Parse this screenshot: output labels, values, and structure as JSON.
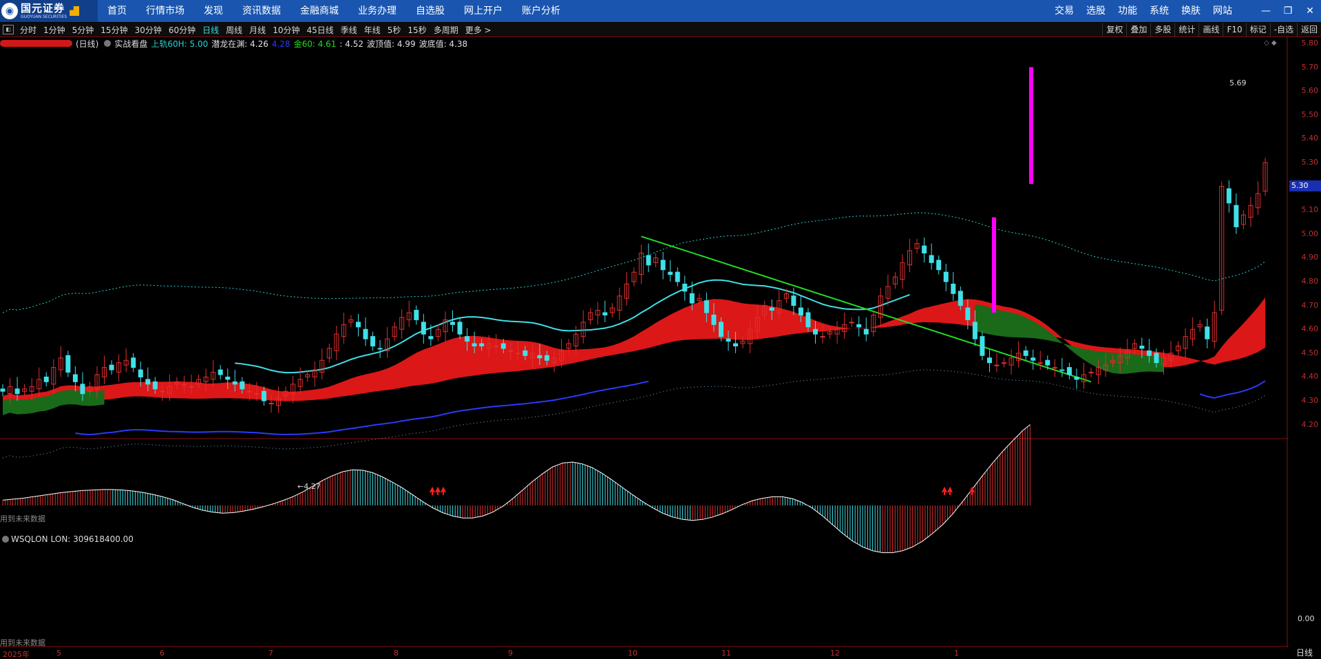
{
  "app": {
    "logo_cn": "国元证券",
    "logo_en": "GUOYUAN SECURITIES"
  },
  "nav": {
    "items": [
      "首页",
      "行情市场",
      "发现",
      "资讯数据",
      "金融商城",
      "业务办理",
      "自选股",
      "网上开户",
      "账户分析"
    ],
    "right_items": [
      "交易",
      "选股",
      "功能",
      "系统",
      "换肤",
      "网站"
    ],
    "window_controls": [
      "—",
      "❐",
      "✕"
    ]
  },
  "periods": {
    "items": [
      "分时",
      "1分钟",
      "5分钟",
      "15分钟",
      "30分钟",
      "60分钟",
      "日线",
      "周线",
      "月线",
      "10分钟",
      "45日线",
      "季线",
      "年线",
      "5秒",
      "15秒",
      "多周期",
      "更多 >"
    ],
    "active": "日线"
  },
  "toolbar": {
    "items": [
      "复权",
      "叠加",
      "多股",
      "统计",
      "画线",
      "F10",
      "标记",
      "-自选",
      "返回"
    ]
  },
  "info": {
    "stock_period": "(日线)",
    "indicator_name": "实战看盘",
    "items": [
      {
        "label": "上轨60H: 5.00",
        "color": "#2ad4d4"
      },
      {
        "label": "潜龙在渊: 4.26",
        "color": "#e0e0e0"
      },
      {
        "label": "4.28",
        "color": "#2a3aff"
      },
      {
        "label": "金60: 4.61",
        "color": "#22dd22"
      },
      {
        "label": ": 4.52",
        "color": "#e0e0e0"
      },
      {
        "label": "波顶值: 4.99",
        "color": "#e0e0e0"
      },
      {
        "label": "波底值: 4.38",
        "color": "#e0e0e0"
      }
    ]
  },
  "sub_info": {
    "indicator": "WSQLON",
    "value": "LON: 309618400.00"
  },
  "labels": {
    "future_data": "用到未来数据",
    "high": "5.69",
    "low": "4.27",
    "current_price": "5.30",
    "sub_zero": "0.00",
    "period": "日线"
  },
  "price_ticks": [
    "5.80",
    "5.70",
    "5.60",
    "5.50",
    "5.40",
    "5.30",
    "5.20",
    "5.10",
    "5.00",
    "4.90",
    "4.80",
    "4.70",
    "4.60",
    "4.50",
    "4.40",
    "4.30",
    "4.20"
  ],
  "date_ticks": [
    "2025年",
    "5",
    "6",
    "7",
    "8",
    "9",
    "10",
    "11",
    "12",
    "1"
  ],
  "colors": {
    "up": "#e03030",
    "down": "#40e0e8",
    "nav_bg": "#1a56b0",
    "upper_band": "#2ad4d4",
    "lower_band": "#2a3aff",
    "trendline": "#22dd22",
    "signal": "#ff00ff"
  },
  "chart_data": {
    "type": "candlestick",
    "title": "",
    "ylim": [
      4.15,
      5.82
    ],
    "x": [
      "2025年",
      "5",
      "6",
      "7",
      "8",
      "9",
      "10",
      "11",
      "12",
      "1"
    ],
    "closes": [
      4.34,
      4.36,
      4.33,
      4.35,
      4.36,
      4.39,
      4.38,
      4.44,
      4.48,
      4.42,
      4.38,
      4.33,
      4.36,
      4.41,
      4.44,
      4.43,
      4.46,
      4.47,
      4.44,
      4.4,
      4.37,
      4.35,
      4.34,
      4.36,
      4.38,
      4.37,
      4.36,
      4.39,
      4.4,
      4.42,
      4.41,
      4.39,
      4.37,
      4.35,
      4.34,
      4.33,
      4.3,
      4.29,
      4.31,
      4.34,
      4.37,
      4.39,
      4.41,
      4.43,
      4.47,
      4.52,
      4.58,
      4.62,
      4.64,
      4.61,
      4.56,
      4.53,
      4.52,
      4.56,
      4.61,
      4.65,
      4.67,
      4.64,
      4.58,
      4.56,
      4.6,
      4.64,
      4.62,
      4.58,
      4.55,
      4.53,
      4.53,
      4.54,
      4.53,
      4.52,
      4.51,
      4.5,
      4.49,
      4.5,
      4.48,
      4.47,
      4.48,
      4.51,
      4.54,
      4.58,
      4.63,
      4.67,
      4.68,
      4.66,
      4.69,
      4.74,
      4.79,
      4.84,
      4.92,
      4.87,
      4.9,
      4.85,
      4.83,
      4.8,
      4.76,
      4.71,
      4.73,
      4.67,
      4.62,
      4.57,
      4.55,
      4.53,
      4.55,
      4.6,
      4.65,
      4.7,
      4.68,
      4.72,
      4.75,
      4.7,
      4.66,
      4.61,
      4.58,
      4.57,
      4.59,
      4.6,
      4.62,
      4.63,
      4.61,
      4.58,
      4.66,
      4.74,
      4.78,
      4.82,
      4.88,
      4.93,
      4.96,
      4.92,
      4.88,
      4.85,
      4.8,
      4.75,
      4.7,
      4.64,
      4.56,
      4.49,
      4.46,
      4.45,
      4.46,
      4.48,
      4.5,
      4.49,
      4.47,
      4.46,
      4.45,
      4.44,
      4.43,
      4.41,
      4.39,
      4.41,
      4.42,
      4.44,
      4.45,
      4.47,
      4.49,
      4.51,
      4.54,
      4.52,
      4.49,
      4.46,
      4.48,
      4.5,
      4.53,
      4.57,
      4.6,
      4.62,
      4.56,
      4.67,
      5.2,
      5.13,
      5.03,
      5.08,
      5.12,
      5.17,
      5.3
    ],
    "wsqlon": [
      0.11,
      0.13,
      0.15,
      0.18,
      0.21,
      0.24,
      0.27,
      0.29,
      0.31,
      0.32,
      0.33,
      0.33,
      0.32,
      0.3,
      0.27,
      0.23,
      0.18,
      0.12,
      0.04,
      -0.04,
      -0.1,
      -0.14,
      -0.16,
      -0.15,
      -0.12,
      -0.08,
      -0.03,
      0.03,
      0.1,
      0.18,
      0.28,
      0.4,
      0.52,
      0.62,
      0.7,
      0.74,
      0.73,
      0.68,
      0.59,
      0.48,
      0.36,
      0.22,
      0.08,
      -0.05,
      -0.15,
      -0.22,
      -0.26,
      -0.26,
      -0.22,
      -0.14,
      -0.02,
      0.14,
      0.32,
      0.5,
      0.66,
      0.8,
      0.88,
      0.9,
      0.86,
      0.78,
      0.66,
      0.52,
      0.37,
      0.22,
      0.08,
      -0.05,
      -0.16,
      -0.24,
      -0.29,
      -0.31,
      -0.29,
      -0.24,
      -0.17,
      -0.08,
      0.02,
      0.1,
      0.15,
      0.18,
      0.18,
      0.14,
      0.06,
      -0.06,
      -0.22,
      -0.4,
      -0.58,
      -0.74,
      -0.86,
      -0.94,
      -0.98,
      -0.98,
      -0.94,
      -0.86,
      -0.74,
      -0.58,
      -0.4,
      -0.18,
      0.08,
      0.35,
      0.62,
      0.88,
      1.12,
      1.34,
      1.55,
      1.72
    ],
    "upper_band_value": 5.0,
    "lower_band_value": 4.28,
    "gold60": 4.61,
    "wave_top": 4.99,
    "wave_bottom": 4.38
  }
}
